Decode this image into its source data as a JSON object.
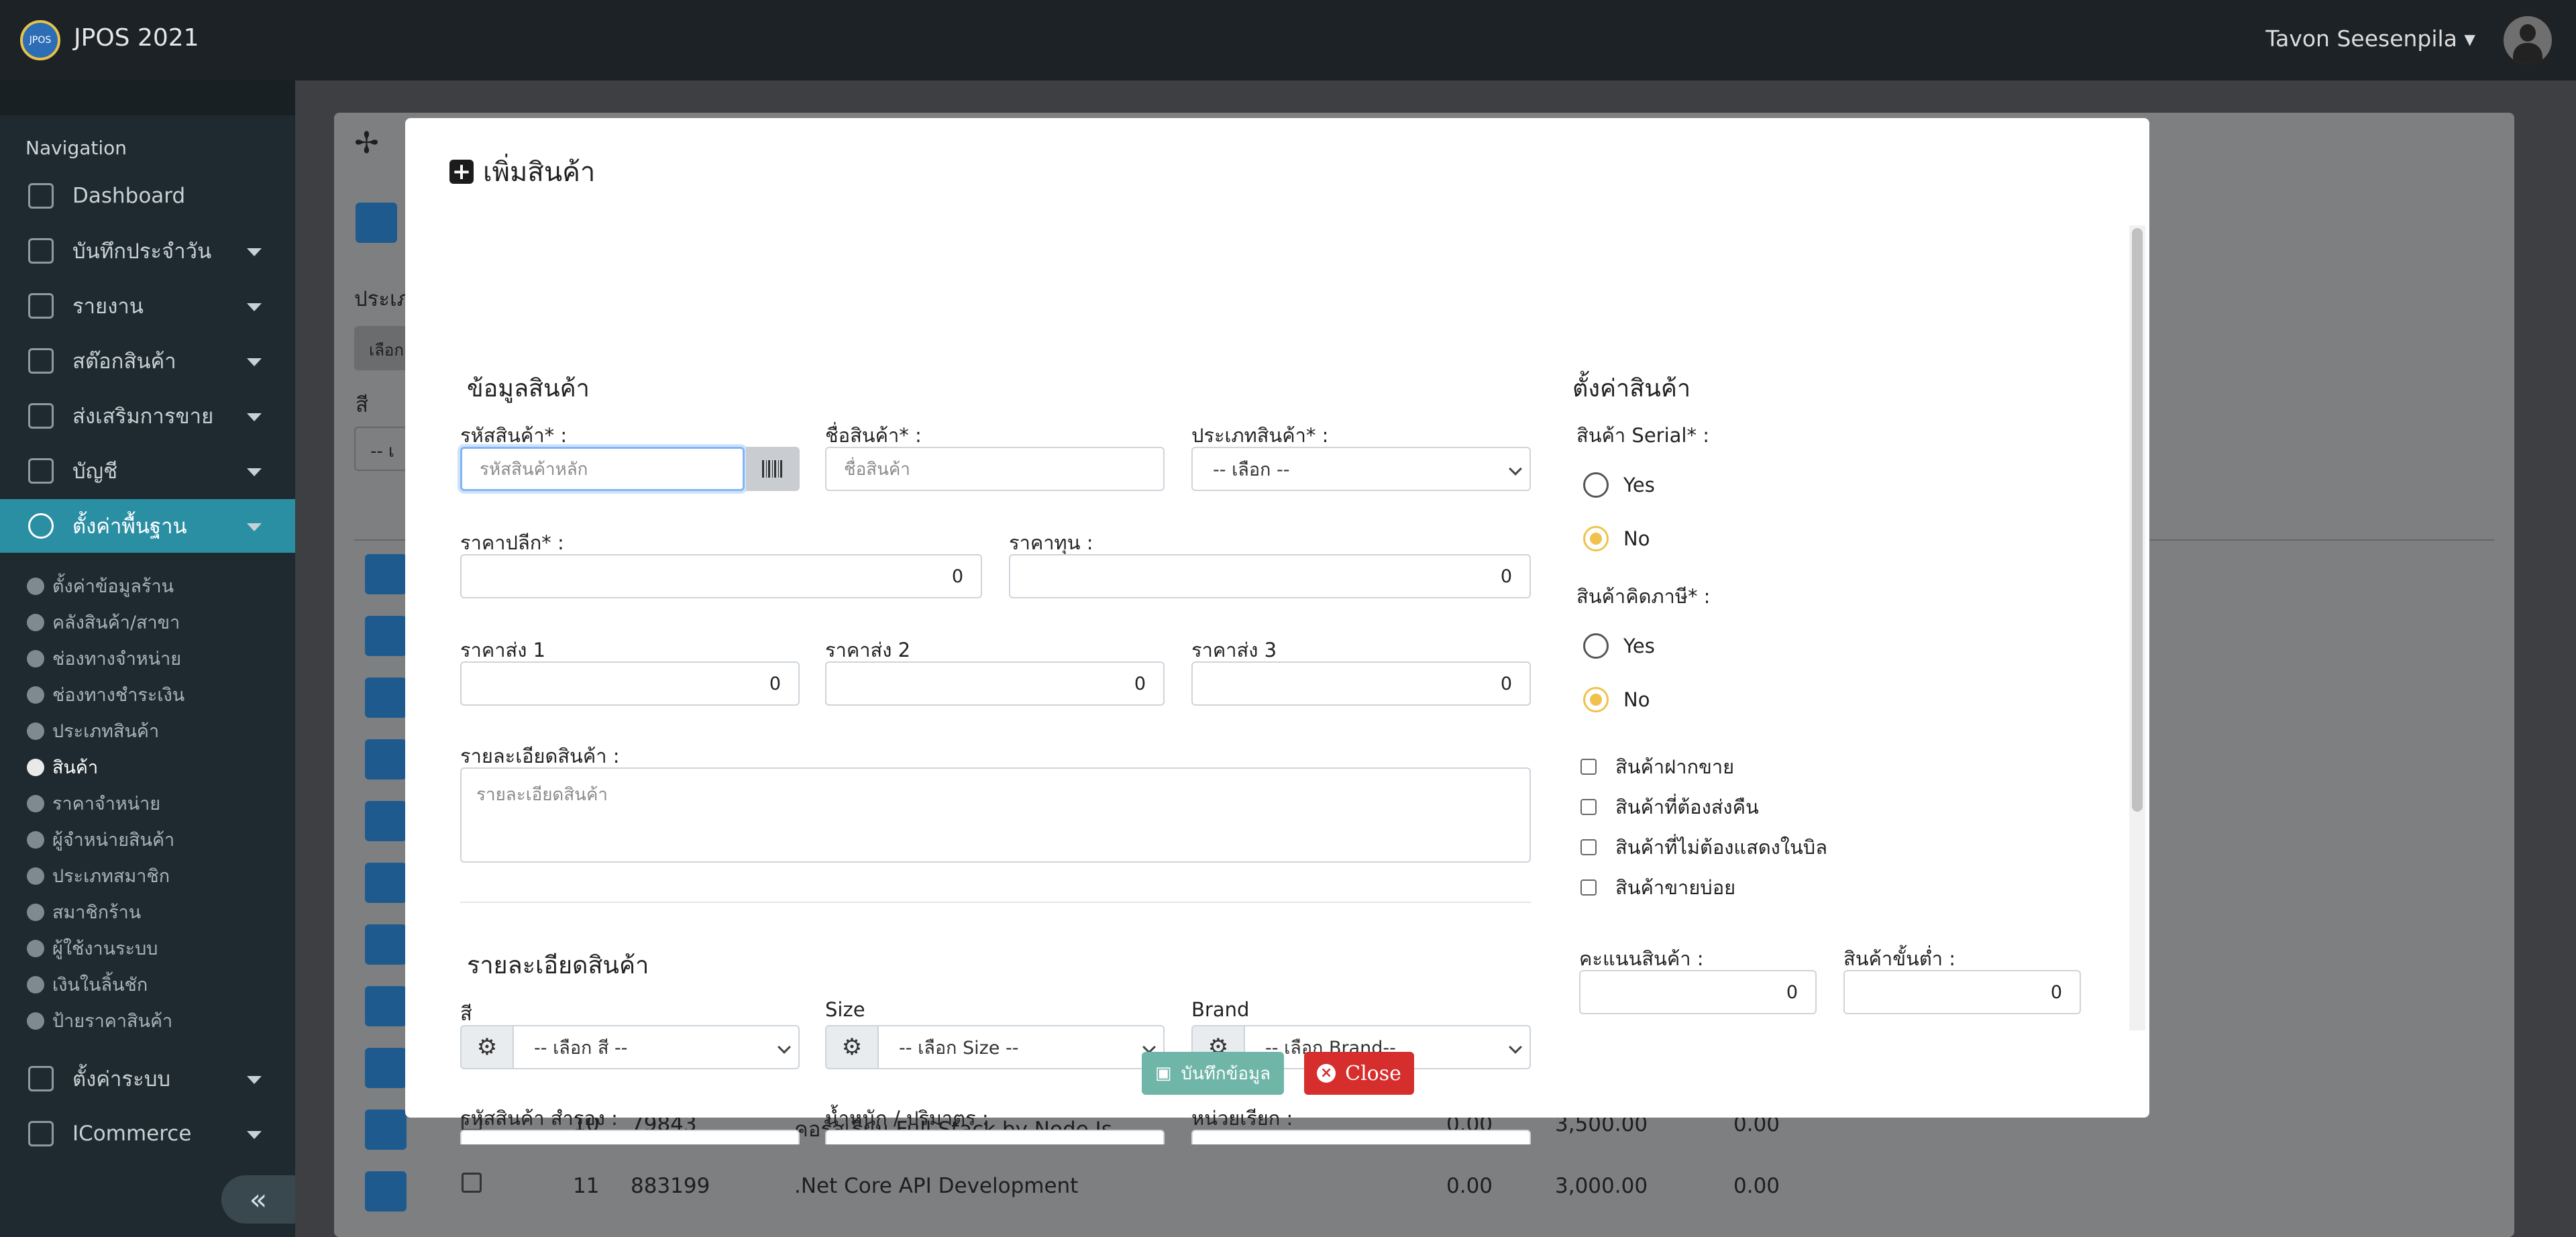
{
  "app": {
    "logo_text": "JPOS",
    "title": "JPOS 2021",
    "user": "Tavon Seesenpila"
  },
  "sidebar": {
    "heading": "Navigation",
    "items": [
      {
        "label": "Dashboard",
        "icon": "dashboard-icon"
      },
      {
        "label": "บันทึกประจำวัน",
        "icon": "printer-icon"
      },
      {
        "label": "รายงาน",
        "icon": "report-icon"
      },
      {
        "label": "สต๊อกสินค้า",
        "icon": "box-icon"
      },
      {
        "label": "ส่งเสริมการขาย",
        "icon": "promotion-icon"
      },
      {
        "label": "บัญชี",
        "icon": "laptop-icon"
      },
      {
        "label": "ตั้งค่าพื้นฐาน",
        "icon": "gear-icon"
      },
      {
        "label": "ตั้งค่าระบบ",
        "icon": "wrench-icon"
      },
      {
        "label": "ICommerce",
        "icon": "phone-icon"
      }
    ],
    "subitems": [
      "ตั้งค่าข้อมูลร้าน",
      "คลังสินค้า/สาขา",
      "ช่องทางจำหน่าย",
      "ช่องทางชำระเงิน",
      "ประเภทสินค้า",
      "สินค้า",
      "ราคาจำหน่าย",
      "ผู้จำหน่ายสินค้า",
      "ประเภทสมาชิก",
      "สมาชิกร้าน",
      "ผู้ใช้งานระบบ",
      "เงินในลิ้นชัก",
      "ป้ายราคาสินค้า"
    ],
    "collapse_icon": "«"
  },
  "background": {
    "fragments": [
      "ประเภ",
      "เลือก",
      "สี",
      "-- เ"
    ],
    "rows": [
      {
        "no": "10",
        "code": "79843",
        "name": "คอร์สเรียน Full Stack by Node Js",
        "v1": "0.00",
        "v2": "3,500.00",
        "v3": "0.00"
      },
      {
        "no": "11",
        "code": "883199",
        "name": ".Net Core API Development",
        "v1": "0.00",
        "v2": "3,000.00",
        "v3": "0.00"
      }
    ]
  },
  "modal": {
    "title": "เพิ่มสินค้า",
    "info": {
      "section": "ข้อมูลสินค้า",
      "code_label": "รหัสสินค้า* :",
      "code_placeholder": "รหัสสินค้าหลัก",
      "name_label": "ชื่อสินค้า* :",
      "name_placeholder": "ชื่อสินค้า",
      "type_label": "ประเภทสินค้า* :",
      "type_value": "-- เลือก --",
      "retail_label": "ราคาปลีก* :",
      "retail_value": "0",
      "cost_label": "ราคาทุน :",
      "cost_value": "0",
      "ws1_label": "ราคาส่ง 1",
      "ws1_value": "0",
      "ws2_label": "ราคาส่ง 2",
      "ws2_value": "0",
      "ws3_label": "ราคาส่ง 3",
      "ws3_value": "0",
      "desc_label": "รายละเอียดสินค้า :",
      "desc_placeholder": "รายละเอียดสินค้า"
    },
    "details": {
      "section": "รายละเอียดสินค้า",
      "color_label": "สี",
      "color_value": "-- เลือก สี --",
      "size_label": "Size",
      "size_value": "-- เลือก Size --",
      "brand_label": "Brand",
      "brand_value": "-- เลือก Brand--",
      "alt_code_label": "รหัสสินค้า สำรอง :",
      "weight_label": "น้ำหนัก / ปริมาตร :",
      "unit_label": "หน่วยเรียก :"
    },
    "settings": {
      "section": "ตั้งค่าสินค้า",
      "serial_label": "สินค้า Serial* :",
      "vat_label": "สินค้าคิดภาษี* :",
      "yes": "Yes",
      "no": "No",
      "checks": [
        "สินค้าฝากขาย",
        "สินค้าที่ต้องส่งคืน",
        "สินค้าที่ไม่ต้องแสดงในบิล",
        "สินค้าขายบ่อย"
      ],
      "points_label": "คะแนนสินค้า :",
      "points_value": "0",
      "min_label": "สินค้าขั้นต่ำ :",
      "min_value": "0"
    },
    "save_label": "บันทึกข้อมูล",
    "close_label": "Close"
  }
}
